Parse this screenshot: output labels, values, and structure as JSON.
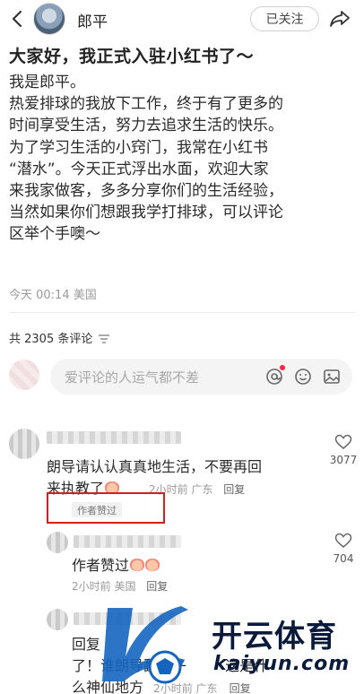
{
  "header": {
    "author_name": "郎平",
    "follow_label": "已关注"
  },
  "post": {
    "title": "大家好，我正式入驻小红书了～",
    "lines": [
      "我是郎平。",
      "热爱排球的我放下工作，终于有了更多的",
      "时间享受生活，努力去追求生活的快乐。",
      "为了学习生活的小窍门，我常在小红书",
      "“潜水”。今天正式浮出水面，欢迎大家",
      "来我家做客，多多分享你们的生活经验，",
      "当然如果你们想跟我学打排球，可以评论",
      "区举个手噢～"
    ],
    "meta": "今天 00:14 美国"
  },
  "comments_section": {
    "count_label": "共 2305 条评论",
    "input_placeholder": "爱评论的人运气都不差"
  },
  "comments": [
    {
      "text_line1": "朗导请认认真真地生活，不要再回",
      "text_line2": "来执教了",
      "time_location": "2小时前 广东",
      "reply_label": "回复",
      "likes": "3077",
      "author_tag": "作者赞过"
    },
    {
      "text": "作者赞过",
      "time_location": "2小时前 美国",
      "reply_label": "回复",
      "likes": "704"
    },
    {
      "text_line1": "回复",
      "text_line2": "了！谁朗导翻牌子",
      "text_line2_tail": "这是什",
      "text_line3": "么神仙地方",
      "time_location": "2小时前 广东",
      "reply_label": "回复"
    }
  ],
  "watermark": {
    "brand": "开云体育",
    "domain": "kaiyun.com"
  },
  "colors": {
    "accent_red": "#ff2442",
    "highlight_box": "#d02020",
    "watermark_blue": "#0a1a3a"
  },
  "icons": [
    "back-icon",
    "share-icon",
    "sort-icon",
    "at-icon",
    "emoji-icon",
    "image-icon",
    "heart-icon"
  ]
}
